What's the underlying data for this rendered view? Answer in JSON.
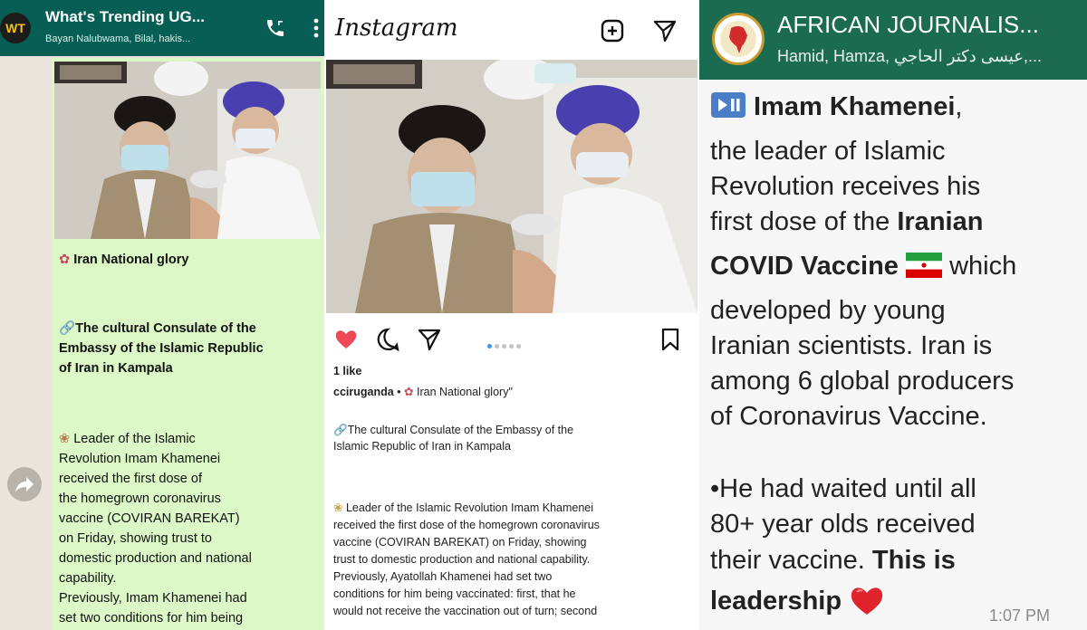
{
  "whatsapp": {
    "avatar_text": "WT",
    "title": "What's Trending UG...",
    "subtitle": "Bayan Nalubwama, Bilal, hakis...",
    "line_glory": "Iran National glory",
    "consulate": [
      "The cultural Consulate of the",
      "Embassy of the Islamic Republic",
      "of Iran in Kampala"
    ],
    "body_lines": [
      "Leader of the Islamic",
      "Revolution Imam Khamenei",
      "received the first dose of",
      "the homegrown coronavirus",
      "vaccine (COVIRAN BAREKAT)",
      "on Friday, showing trust to",
      "domestic production and national",
      "capability.",
      "Previously, Imam Khamenei had",
      "set two conditions for him being"
    ]
  },
  "instagram": {
    "logo": "Instagram",
    "likes": "1 like",
    "caption_user": "cciruganda",
    "caption_text": "Iran National glory\"",
    "consulate": [
      "The cultural Consulate of the Embassy of the",
      "Islamic Republic of Iran in Kampala"
    ],
    "body_lines": [
      "Leader of the Islamic Revolution Imam Khamenei",
      "received the first dose of the homegrown coronavirus",
      "vaccine (COVIRAN BAREKAT) on Friday, showing",
      "trust to domestic production and national capability.",
      "Previously, Ayatollah Khamenei had set two",
      "conditions for him being vaccinated: first, that he",
      "would not receive the vaccination out of turn; second"
    ]
  },
  "journalists": {
    "title": "AFRICAN JOURNALIS...",
    "subtitle": "Hamid, Hamza, عیسی دکتر الحاجي,...",
    "msg_name": "Imam Khamenei",
    "msg_lines": [
      "the leader of Islamic",
      "Revolution receives his",
      "first dose of the"
    ],
    "msg_bold_iranian": "Iranian",
    "msg_bold_covid": "COVID Vaccine",
    "msg_which": "which",
    "msg_lines2": [
      "developed by young",
      "Iranian scientists. Iran is",
      "among 6 global producers",
      "of Coronavirus Vaccine."
    ],
    "msg_lines3": [
      "•He had waited until all",
      "80+ year olds received"
    ],
    "msg_vaccine": "their vaccine.",
    "msg_this_is": "This is",
    "msg_leadership": "leadership",
    "time": "1:07 PM"
  },
  "colors": {
    "whatsapp_header": "#075e54",
    "whatsapp_bubble": "#dcf8c6",
    "journalists_header": "#1a6b4f",
    "instagram_like": "#ed4956"
  }
}
